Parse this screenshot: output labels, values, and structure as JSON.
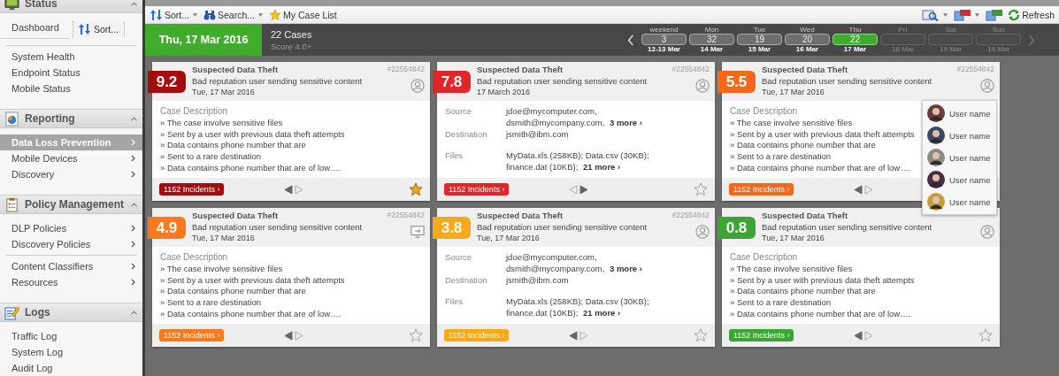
{
  "sidebar": {
    "sort_popup": {
      "label": "Sort..."
    },
    "sections": [
      {
        "title": "Status",
        "expanded": true,
        "groups": [
          [
            {
              "label": "Dashboard",
              "selected": false,
              "submenu": false
            }
          ],
          [
            {
              "label": "System Health",
              "selected": false,
              "submenu": false
            },
            {
              "label": "Endpoint Status",
              "selected": false,
              "submenu": false
            },
            {
              "label": "Mobile Status",
              "selected": false,
              "submenu": false
            }
          ]
        ]
      },
      {
        "title": "Reporting",
        "expanded": true,
        "groups": [
          [
            {
              "label": "Data Loss Prevention",
              "selected": true,
              "submenu": true
            },
            {
              "label": "Mobile Devices",
              "selected": false,
              "submenu": true
            },
            {
              "label": "Discovery",
              "selected": false,
              "submenu": true
            }
          ]
        ]
      },
      {
        "title": "Policy Management",
        "expanded": true,
        "groups": [
          [
            {
              "label": "DLP Policies",
              "selected": false,
              "submenu": true
            },
            {
              "label": "Discovery Policies",
              "selected": false,
              "submenu": true
            }
          ],
          [
            {
              "label": "Content Classifiers",
              "selected": false,
              "submenu": true
            },
            {
              "label": "Resources",
              "selected": false,
              "submenu": true
            }
          ]
        ]
      },
      {
        "title": "Logs",
        "expanded": true,
        "groups": [
          [
            {
              "label": "Traffic Log",
              "selected": false,
              "submenu": false
            },
            {
              "label": "System Log",
              "selected": false,
              "submenu": false
            },
            {
              "label": "Audit Log",
              "selected": false,
              "submenu": false
            }
          ]
        ]
      }
    ]
  },
  "toolbar": {
    "left": [
      {
        "kind": "sort",
        "label": "Sort...",
        "dropdown": true
      },
      {
        "kind": "binoculars",
        "label": "Search...",
        "dropdown": true
      },
      {
        "kind": "star",
        "label": "My Case List",
        "dropdown": false
      }
    ],
    "right": [
      {
        "kind": "zoom",
        "dropdown": true
      },
      {
        "kind": "pdf",
        "dropdown": true
      },
      {
        "kind": "csv",
        "dropdown": false
      },
      {
        "kind": "refresh",
        "label": "Refresh",
        "dropdown": false
      }
    ]
  },
  "header": {
    "date": "Thu, 17 Mar 2016",
    "cases": "22 Cases",
    "score": "Score 4.0+",
    "days": [
      {
        "day": "weekend",
        "count": "3",
        "date": "12-13 Mar",
        "selected": false,
        "disabled": false
      },
      {
        "day": "Mon",
        "count": "32",
        "date": "14 Mar",
        "selected": false,
        "disabled": false
      },
      {
        "day": "Tue",
        "count": "19",
        "date": "15 Mar",
        "selected": false,
        "disabled": false
      },
      {
        "day": "Wed",
        "count": "20",
        "date": "16 Mar",
        "selected": false,
        "disabled": false
      },
      {
        "day": "Thu",
        "count": "22",
        "date": "17 Mar",
        "selected": true,
        "disabled": false
      },
      {
        "day": "Fri",
        "date": "18 Mar",
        "selected": false,
        "disabled": true
      },
      {
        "day": "Sat",
        "date": "19 Mar",
        "selected": false,
        "disabled": true
      },
      {
        "day": "Sun",
        "date": "19 Mar",
        "selected": false,
        "disabled": true
      }
    ]
  },
  "cards": [
    {
      "kind": "description",
      "score": "9.2",
      "color": "#a30d0d",
      "title": "Suspected Data Theft",
      "subtitle": "Bad reputation user sending sensitive content",
      "date": "Tue, 17 Mar 2016",
      "case_id": "#22554842",
      "heading": "Case Description",
      "lines": [
        "» The case involve sensitive files",
        "» Sent by a user with previous data theft attempts",
        "» Data contains phone number that are",
        "» Sent to a rare destination",
        "» Data contains phone number that are of low…."
      ],
      "incidents": "1152 Incidents ›",
      "prev_on": true,
      "next_on": false,
      "starred": true
    },
    {
      "kind": "details",
      "score": "7.8",
      "color": "#e0262a",
      "title": "Suspected Data Theft",
      "subtitle": "Bad reputation user sending sensitive content",
      "date": "17 March 2016",
      "case_id": "#22554842",
      "fields": [
        {
          "label": "Source",
          "lines": [
            "jdoe@mycomputer.com,",
            "dsmith@mycompany.com,"
          ],
          "more": "3 more ›"
        },
        {
          "label": "Destination",
          "lines": [
            "jsmith@ibm.com"
          ]
        },
        {
          "label": "Files",
          "lines": [
            "MyData.xls (258KB); Data.csv (30KB);",
            "finance.dat (10KB);"
          ],
          "more": "21 more ›"
        }
      ],
      "incidents": "1152 Incidents ›",
      "prev_on": false,
      "next_on": true,
      "starred": false
    },
    {
      "kind": "description",
      "score": "5.5",
      "color": "#f2691c",
      "title": "Suspected Data Theft",
      "subtitle": "Bad reputation user sending sensitive content",
      "date": "Tue, 17 Mar 2016",
      "case_id": "#22554842",
      "heading": "Case Description",
      "lines": [
        "» The case involve sensitive files",
        "» Sent by a user with previous data theft attempts",
        "» Data contains phone number that are",
        "» Sent to a rare destination",
        "» Data contains phone number that are of low…."
      ],
      "incidents": "1152 Incidents ›",
      "prev_on": true,
      "next_on": false,
      "assignee_menu": [
        {
          "name": "User name"
        },
        {
          "name": "User name"
        },
        {
          "name": "User name"
        },
        {
          "name": "User name"
        },
        {
          "name": "User name"
        }
      ]
    },
    {
      "kind": "description",
      "score": "4.9",
      "color": "#f77b1e",
      "title": "Suspected Data Theft",
      "subtitle": "Bad reputation user sending sensitive content",
      "date": "Tue, 17 Mar 2016",
      "case_id": "#22554842",
      "heading": "Case Description",
      "lines": [
        "» The case involve sensitive files",
        "» Sent by a user with previous data theft attempts",
        "» Data contains phone number that are",
        "» Sent to a rare destination",
        "» Data contains phone number that are of low…."
      ],
      "incidents": "1152 Incidents ›",
      "prev_on": true,
      "next_on": false,
      "starred": false
    },
    {
      "kind": "details",
      "score": "3.8",
      "color": "#f8a91b",
      "title": "Suspected Data Theft",
      "subtitle": "Bad reputation user sending sensitive content",
      "date": "Tue, 17 Mar 2016",
      "case_id": "#22554842",
      "fields": [
        {
          "label": "Source",
          "lines": [
            "jdoe@mycomputer.com,",
            "dsmith@mycompany.com,"
          ],
          "more": "3 more ›"
        },
        {
          "label": "Destination",
          "lines": [
            "jsmith@ibm.com"
          ]
        },
        {
          "label": "Files",
          "lines": [
            "MyData.xls (258KB); Data.csv (30KB);",
            "finance.dat (10KB);"
          ],
          "more": "21 more ›"
        }
      ],
      "incidents": "1152 Incidents ›",
      "prev_on": true,
      "next_on": false,
      "starred": false
    },
    {
      "kind": "description",
      "score": "0.8",
      "color": "#3ba633",
      "title": "Suspected Data Theft",
      "subtitle": "Bad reputation user sending sensitive content",
      "date": "Tue, 17 Mar 2016",
      "heading": "Case Description",
      "lines": [
        "» The case involve sensitive files",
        "» Sent by a user with previous data theft attempts",
        "» Data contains phone number that are",
        "» Sent to a rare destination",
        "» Data contains phone number that are of low…."
      ],
      "incidents": "1152 Incidents ›",
      "prev_on": true,
      "next_on": false,
      "starred": false
    }
  ]
}
